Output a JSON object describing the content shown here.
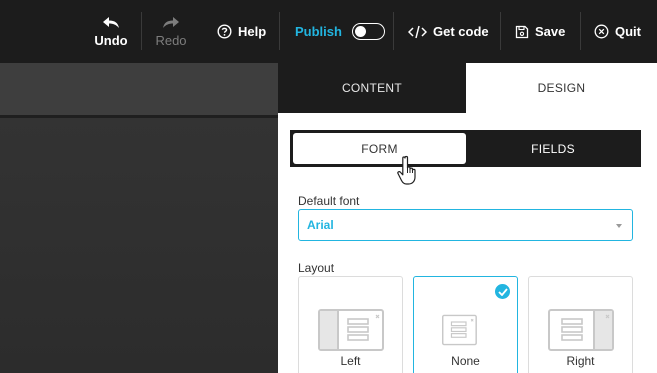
{
  "toolbar": {
    "undo_label": "Undo",
    "redo_label": "Redo",
    "help_label": "Help",
    "publish_label": "Publish",
    "publish_on": false,
    "get_code_label": "Get code",
    "save_label": "Save",
    "quit_label": "Quit"
  },
  "panel": {
    "tabs": [
      {
        "label": "CONTENT",
        "active": false
      },
      {
        "label": "DESIGN",
        "active": true
      }
    ],
    "segment": [
      {
        "label": "FORM",
        "active": true
      },
      {
        "label": "FIELDS",
        "active": false
      }
    ],
    "default_font": {
      "label": "Default font",
      "value": "Arial"
    },
    "layout": {
      "label": "Layout",
      "options": [
        {
          "label": "Left",
          "selected": false
        },
        {
          "label": "None",
          "selected": true
        },
        {
          "label": "Right",
          "selected": false
        }
      ]
    }
  },
  "colors": {
    "accent": "#22b5e0",
    "topbar": "#1c1c1c",
    "canvas": "#2b2b2b"
  }
}
